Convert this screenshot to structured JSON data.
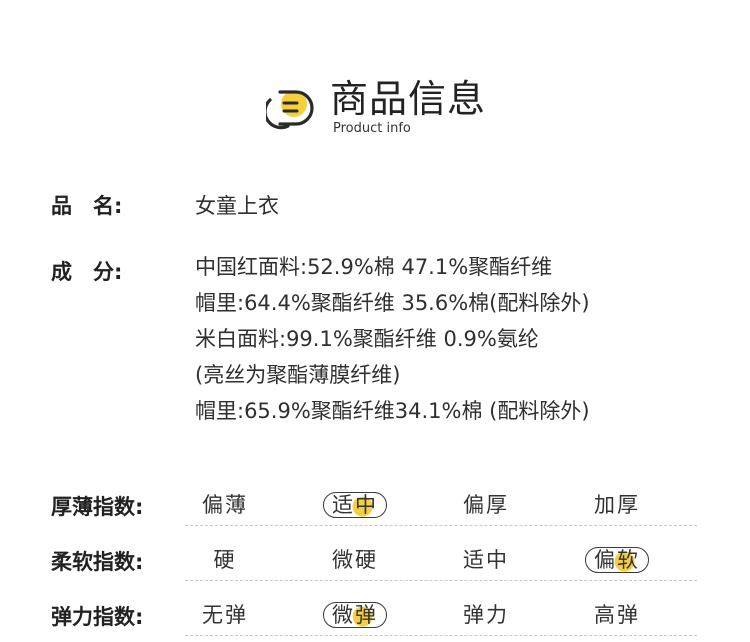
{
  "header": {
    "title_cn": "商品信息",
    "title_en": "Product info",
    "icon": "document-lines-icon",
    "accent_color": "#f4d03f"
  },
  "product": {
    "name_label": "品　名:",
    "name_value": "女童上衣",
    "composition_label": "成　分:",
    "composition_lines": [
      "中国红面料:52.9%棉 47.1%聚酯纤维",
      "帽里:64.4%聚酯纤维 35.6%棉(配料除外)",
      "米白面料:99.1%聚酯纤维 0.9%氨纶",
      " (亮丝为聚酯薄膜纤维)",
      "帽里:65.9%聚酯纤维34.1%棉 (配料除外)"
    ]
  },
  "indices": [
    {
      "label": "厚薄指数:",
      "options": [
        "偏薄",
        "适中",
        "偏厚",
        "加厚"
      ],
      "selected": 1
    },
    {
      "label": "柔软指数:",
      "options": [
        "硬",
        "微硬",
        "适中",
        "偏软"
      ],
      "selected": 3
    },
    {
      "label": "弹力指数:",
      "options": [
        "无弹",
        "微弹",
        "弹力",
        "高弹"
      ],
      "selected": 1
    }
  ]
}
